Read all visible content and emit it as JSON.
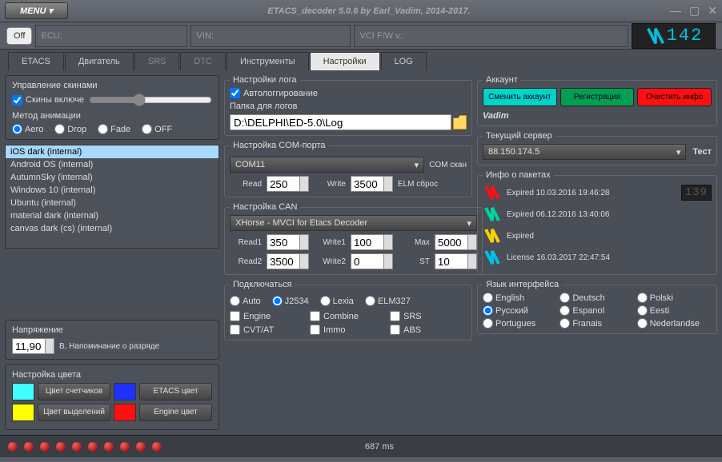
{
  "window": {
    "menu": "MENU",
    "title": "ETACS_decoder 5.0.6 by Earl_Vadim, 2014-2017."
  },
  "topbar": {
    "off": "Off",
    "ecu": "ECU:",
    "vin": "VIN:",
    "vci": "VCI F/W v.:",
    "counter": "142"
  },
  "tabs": [
    "ETACS",
    "Двигатель",
    "SRS",
    "DTC",
    "Инструменты",
    "Настройки",
    "LOG"
  ],
  "active_tab": 5,
  "skins": {
    "title": "Управление скинами",
    "enabled_label": "Скины включе",
    "anim_label": "Метод анимации",
    "anim_options": [
      "Aero",
      "Drop",
      "Fade",
      "OFF"
    ],
    "anim_selected": "Aero",
    "list": [
      "iOS dark (internal)",
      "Android OS (internal)",
      "AutumnSky (internal)",
      "Windows 10 (internal)",
      "Ubuntu (internal)",
      "material dark (internal)",
      "canvas dark (cs) (internal)"
    ],
    "selected": 0
  },
  "voltage": {
    "title": "Напряжение",
    "value": "11,90",
    "hint": "В, Напоминание о разряде"
  },
  "colors": {
    "title": "Настройка цвета",
    "counter_btn": "Цвет счетчиков",
    "etacs_btn": "ETACS цвет",
    "highlight_btn": "Цвет выделений",
    "engine_btn": "Engine цвет",
    "swatch1": "#40ffff",
    "swatch2": "#2030ff",
    "swatch3": "#ffff00",
    "swatch4": "#ff1010"
  },
  "log": {
    "title": "Настройки лога",
    "autolog": "Автологгирование",
    "folder_label": "Папка для логов",
    "folder": "D:\\DELPHI\\ED-5.0\\Log"
  },
  "com": {
    "title": "Настройка COM-порта",
    "port": "COM11",
    "scan": "COM скан",
    "read_label": "Read",
    "read": "250",
    "write_label": "Write",
    "write": "3500",
    "reset": "ELM сброс"
  },
  "can": {
    "title": "Настройка CAN",
    "device": "XHorse - MVCI for Etacs Decoder",
    "read1_label": "Read1",
    "read1": "350",
    "write1_label": "Write1",
    "write1": "100",
    "max_label": "Max",
    "max": "5000",
    "read2_label": "Read2",
    "read2": "3500",
    "write2_label": "Write2",
    "write2": "0",
    "st_label": "ST",
    "st": "10"
  },
  "connect": {
    "title": "Подключаться",
    "modes": [
      "Auto",
      "J2534",
      "Lexia",
      "ELM327"
    ],
    "selected": "J2534",
    "systems": [
      "Engine",
      "Combine",
      "SRS",
      "CVT/AT",
      "Immo",
      "ABS"
    ]
  },
  "account": {
    "title": "Аккаунт",
    "change": "Сменить аккаунт",
    "register": "Регистрация",
    "clear": "Очистить инфо",
    "user": "Vadim"
  },
  "server": {
    "title": "Текущий сервер",
    "value": "88.150.174.5",
    "test": "Тест"
  },
  "packages": {
    "title": "Инфо о пакетах",
    "items": [
      {
        "color": "#ff1010",
        "text": "Expired 10.03.2016 19:46:28"
      },
      {
        "color": "#00d4a0",
        "text": "Expired 06.12.2016 13:40:06"
      },
      {
        "color": "#ffd000",
        "text": "Expired"
      },
      {
        "color": "#00bfe6",
        "text": "License 16.03.2017 22:47:54"
      }
    ],
    "mini_counter": "139"
  },
  "lang": {
    "title": "Язык интерфейса",
    "options": [
      "English",
      "Deutsch",
      "Polski",
      "Русский",
      "Espanol",
      "Eesti",
      "Portugues",
      "Franais",
      "Nederlandse"
    ],
    "selected": "Русский"
  },
  "status": {
    "time": "687 ms"
  }
}
